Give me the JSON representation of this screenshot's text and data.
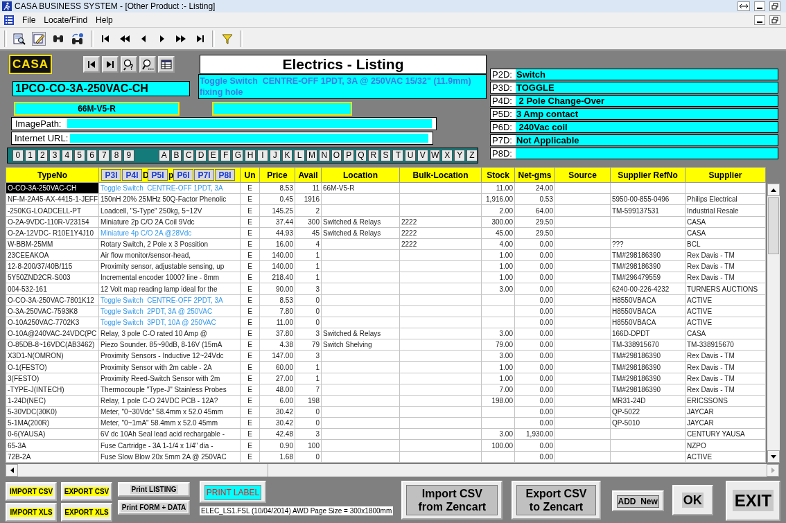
{
  "window": {
    "title": "CASA BUSINESS SYSTEM - [Other Product :- Listing]"
  },
  "menu": [
    "File",
    "Locate/Find",
    "Help"
  ],
  "logo": "CASA",
  "form": {
    "title": "Electrics - Listing",
    "part_number": "1PCO-CO-3A-250VAC-CH",
    "description": "Toggle Switch  CENTRE-OFF 1PDT, 3A @ 250VAC 15/32\" (11.9mm) fixing hole",
    "location": "66M-V5-R",
    "image_path_label": "ImagePath:",
    "internet_url_label": "Internet URL:"
  },
  "digit_keys": [
    "0",
    "1",
    "2",
    "3",
    "4",
    "5",
    "6",
    "7",
    "8",
    "9"
  ],
  "letter_keys": [
    "A",
    "B",
    "C",
    "D",
    "E",
    "F",
    "G",
    "H",
    "I",
    "J",
    "K",
    "L",
    "M",
    "N",
    "O",
    "P",
    "Q",
    "R",
    "S",
    "T",
    "U",
    "V",
    "W",
    "X",
    "Y",
    "Z"
  ],
  "properties": [
    {
      "label": "P2D:",
      "value": "Switch"
    },
    {
      "label": "P3D:",
      "value": "TOGGLE"
    },
    {
      "label": "P4D:",
      "value": " 2 Pole Change-Over"
    },
    {
      "label": "P5D:",
      "value": "3 Amp contact"
    },
    {
      "label": "P6D:",
      "value": " 240Vac coil"
    },
    {
      "label": "P7D:",
      "value": "Not Applicable"
    },
    {
      "label": "P8D:"
    }
  ],
  "table": {
    "columns": [
      {
        "kind": "text",
        "label": "TypeNo"
      },
      {
        "kind": "buttons",
        "parts": [
          {
            "kind": "button",
            "label": "P3I"
          },
          {
            "kind": "button",
            "label": "P4I"
          },
          {
            "kind": "text",
            "label": "D"
          },
          {
            "kind": "button",
            "label": "P5I"
          },
          {
            "kind": "text",
            "label": "p"
          },
          {
            "kind": "button",
            "label": "P6I"
          },
          {
            "kind": "button",
            "label": "P7I"
          },
          {
            "kind": "button",
            "label": "P8I"
          }
        ]
      },
      {
        "kind": "text",
        "label": "Un"
      },
      {
        "kind": "text",
        "label": "Price"
      },
      {
        "kind": "text",
        "label": "Avail"
      },
      {
        "kind": "text",
        "label": "Location"
      },
      {
        "kind": "text",
        "label": "Bulk-Location"
      },
      {
        "kind": "text",
        "label": "Stock"
      },
      {
        "kind": "text",
        "label": "Net-gms"
      },
      {
        "kind": "text",
        "label": "Source"
      },
      {
        "kind": "text",
        "label": "Supplier RefNo"
      },
      {
        "kind": "text",
        "label": "Supplier"
      }
    ],
    "rows": [
      {
        "selected": true,
        "highlighted": true,
        "type_no": "O-CO-3A-250VAC-CH",
        "description": "Toggle Switch  CENTRE-OFF 1PDT, 3A",
        "unit": "E",
        "price": "8.53",
        "avail": "11",
        "location": "66M-V5-R",
        "stock": "11.00",
        "net_gms": "24.00"
      },
      {
        "selected": false,
        "highlighted": false,
        "type_no": "NF-M-2A45-AX-4415-1-JEFF",
        "description": "150nH 20% 25MHz 50Q-Factor Phenolic",
        "unit": "E",
        "price": "0.45",
        "avail": "1916",
        "stock": "1,916.00",
        "net_gms": "0.53",
        "supplier_ref": "5950-00-855-0496",
        "supplier": "Philips Electrical"
      },
      {
        "selected": false,
        "highlighted": false,
        "type_no": "-250KG-LOADCELL-PT",
        "description": "Loadcell, \"S-Type\" 250kg, 5~12V",
        "unit": "E",
        "price": "145.25",
        "avail": "2",
        "stock": "2.00",
        "net_gms": "64.00",
        "supplier_ref": "TM-599137531",
        "supplier": "Industrial Resale"
      },
      {
        "selected": false,
        "highlighted": false,
        "type_no": "O-2A-9VDC-110R-V23154",
        "description": "Miniature 2p C/O 2A Coil 9Vdc",
        "unit": "E",
        "price": "37.44",
        "avail": "300",
        "location": "Switched & Relays",
        "bulk_location": "2222",
        "stock": "300.00",
        "net_gms": "29.50",
        "supplier": "CASA"
      },
      {
        "selected": false,
        "highlighted": true,
        "type_no": "O-2A-12VDC- R10E1Y4J10",
        "description": "Miniature 4p C/O 2A @28Vdc",
        "unit": "E",
        "price": "44.93",
        "avail": "45",
        "location": "Switched & Relays",
        "bulk_location": "2222",
        "stock": "45.00",
        "net_gms": "29.50",
        "supplier": "CASA"
      },
      {
        "selected": false,
        "highlighted": false,
        "type_no": "W-BBM-25MM",
        "description": "Rotary Switch, 2 Pole x 3 Possition",
        "unit": "E",
        "price": "16.00",
        "avail": "4",
        "bulk_location": "2222",
        "stock": "4.00",
        "net_gms": "0.00",
        "supplier_ref": "???",
        "supplier": "BCL"
      },
      {
        "selected": false,
        "highlighted": false,
        "type_no": "23CEEAKOA",
        "description": "Air flow monitor/sensor-head,",
        "unit": "E",
        "price": "140.00",
        "avail": "1",
        "stock": "1.00",
        "net_gms": "0.00",
        "supplier_ref": "TM#298186390",
        "supplier": "Rex Davis - TM"
      },
      {
        "selected": false,
        "highlighted": false,
        "type_no": "12-8-200/37/40B/115",
        "description": "Proximity sensor, adjustable sensing, up",
        "unit": "E",
        "price": "140.00",
        "avail": "1",
        "stock": "1.00",
        "net_gms": "0.00",
        "supplier_ref": "TM#298186390",
        "supplier": "Rex Davis - TM"
      },
      {
        "selected": false,
        "highlighted": false,
        "type_no": "5Y50ZND2CR-S003",
        "description": "Incremental encoder 1000? line - 8mm",
        "unit": "E",
        "price": "218.40",
        "avail": "1",
        "stock": "1.00",
        "net_gms": "0.00",
        "supplier_ref": "TM#296479559",
        "supplier": "Rex Davis - TM"
      },
      {
        "selected": false,
        "highlighted": false,
        "type_no": "004-532-161",
        "description": "12 Volt map reading lamp ideal for the",
        "unit": "E",
        "price": "90.00",
        "avail": "3",
        "stock": "3.00",
        "net_gms": "0.00",
        "supplier_ref": "6240-00-226-4232",
        "supplier": "TURNERS AUCTIONS"
      },
      {
        "selected": false,
        "highlighted": true,
        "type_no": "O-CO-3A-250VAC-7801K12",
        "description": "Toggle Switch  CENTRE-OFF 2PDT, 3A",
        "unit": "E",
        "price": "8.53",
        "avail": "0",
        "net_gms": "0.00",
        "supplier_ref": "H8550VBACA",
        "supplier": "ACTIVE"
      },
      {
        "selected": false,
        "highlighted": true,
        "type_no": "O-3A-250VAC-7593K8",
        "description": "Toggle Switch  2PDT, 3A @ 250VAC",
        "unit": "E",
        "price": "7.80",
        "avail": "0",
        "net_gms": "0.00",
        "supplier_ref": "H8550VBACA",
        "supplier": "ACTIVE"
      },
      {
        "selected": false,
        "highlighted": true,
        "type_no": "O-10A250VAC-7702K3",
        "description": "Toggle Switch  3PDT, 10A @ 250VAC",
        "unit": "E",
        "price": "11.00",
        "avail": "0",
        "net_gms": "0.00",
        "supplier_ref": "H8550VBACA",
        "supplier": "ACTIVE"
      },
      {
        "selected": false,
        "highlighted": false,
        "type_no": "O-10A@240VAC-24VDC(PC",
        "description": "Relay, 3 pole C-O rated 10 Amp @",
        "unit": "E",
        "price": "37.80",
        "avail": "3",
        "location": "Switched & Relays",
        "stock": "3.00",
        "net_gms": "0.00",
        "supplier_ref": "166D-DPDT",
        "supplier": "CASA"
      },
      {
        "selected": false,
        "highlighted": false,
        "type_no": "O-85DB-8~16VDC(AB3462)",
        "description": "Piezo Sounder. 85~90dB, 8-16V (15mA",
        "unit": "E",
        "price": "4.38",
        "avail": "79",
        "location": "Switch Shelving",
        "stock": "79.00",
        "net_gms": "0.00",
        "supplier_ref": "TM-338915670",
        "supplier": "TM-338915670"
      },
      {
        "selected": false,
        "highlighted": false,
        "type_no": "X3D1-N(OMRON)",
        "description": "Proximity Sensors - Inductive 12~24Vdc",
        "unit": "E",
        "price": "147.00",
        "avail": "3",
        "stock": "3.00",
        "net_gms": "0.00",
        "supplier_ref": "TM#298186390",
        "supplier": "Rex Davis - TM"
      },
      {
        "selected": false,
        "highlighted": false,
        "type_no": "O-1(FESTO)",
        "description": "Proximity Sensor with 2m cable - 2A",
        "unit": "E",
        "price": "60.00",
        "avail": "1",
        "stock": "1.00",
        "net_gms": "0.00",
        "supplier_ref": "TM#298186390",
        "supplier": "Rex Davis - TM"
      },
      {
        "selected": false,
        "highlighted": false,
        "type_no": "3(FESTO)",
        "description": "Proximity Reed-Switch Sensor with 2m",
        "unit": "E",
        "price": "27.00",
        "avail": "1",
        "stock": "1.00",
        "net_gms": "0.00",
        "supplier_ref": "TM#298186390",
        "supplier": "Rex Davis - TM"
      },
      {
        "selected": false,
        "highlighted": false,
        "type_no": "-TYPE-J(INTECH)",
        "description": "Thermocouple \"Type-J\" Stainless Probes",
        "unit": "E",
        "price": "48.00",
        "avail": "7",
        "stock": "7.00",
        "net_gms": "0.00",
        "supplier_ref": "TM#298186390",
        "supplier": "Rex Davis - TM"
      },
      {
        "selected": false,
        "highlighted": false,
        "type_no": "1-24D(NEC)",
        "description": "Relay, 1 pole C-O 24VDC PCB - 12A?",
        "unit": "E",
        "price": "6.00",
        "avail": "198",
        "stock": "198.00",
        "net_gms": "0.00",
        "supplier_ref": "MR31-24D",
        "supplier": "ERICSSONS"
      },
      {
        "selected": false,
        "highlighted": false,
        "type_no": "5-30VDC(30K0)",
        "description": "Meter, \"0~30Vdc\" 58.4mm x 52.0 45mm",
        "unit": "E",
        "price": "30.42",
        "avail": "0",
        "net_gms": "0.00",
        "supplier_ref": "QP-5022",
        "supplier": "JAYCAR"
      },
      {
        "selected": false,
        "highlighted": false,
        "type_no": "5-1MA(200R)",
        "description": "Meter, \"0~1mA\" 58.4mm x 52.0 45mm",
        "unit": "E",
        "price": "30.42",
        "avail": "0",
        "net_gms": "0.00",
        "supplier_ref": "QP-5010",
        "supplier": "JAYCAR"
      },
      {
        "selected": false,
        "highlighted": false,
        "type_no": "0-6(YAUSA)",
        "description": "6V dc 10Ah Seal lead acid rechargable -",
        "unit": "E",
        "price": "42.48",
        "avail": "3",
        "stock": "3.00",
        "net_gms": "1,930.00",
        "supplier": "CENTURY YAUSA"
      },
      {
        "selected": false,
        "highlighted": false,
        "type_no": "65-3A",
        "description": "Fuse Cartridge - 3A 1-1/4 x 1/4\" dia -",
        "unit": "E",
        "price": "0.90",
        "avail": "100",
        "stock": "100.00",
        "net_gms": "0.00",
        "supplier": "NZPO"
      },
      {
        "selected": false,
        "highlighted": false,
        "type_no": "72B-2A",
        "description": "Fuse Slow Blow 20x 5mm 2A @ 250VAC",
        "unit": "E",
        "price": "1.68",
        "avail": "0",
        "net_gms": "0.00",
        "supplier": "ACTIVE"
      }
    ]
  },
  "data_buttons": [
    "IMPORT CSV",
    "EXPORT CSV",
    "IMPORT XLS",
    "EXPORT XLS"
  ],
  "print_buttons": [
    "Print LISTING",
    "Print FORM + DATA"
  ],
  "label_button": "PRINT LABEL",
  "file_info": "ELEC_LS1.FSL (10/04/2014) AWD Page Size = 300x1800mm",
  "zencart_buttons": [
    "Import CSV\nfrom Zencart",
    "Export CSV\nto Zencart"
  ],
  "add_button": "ADD  New",
  "ok_button": "OK",
  "exit_button": "EXIT"
}
